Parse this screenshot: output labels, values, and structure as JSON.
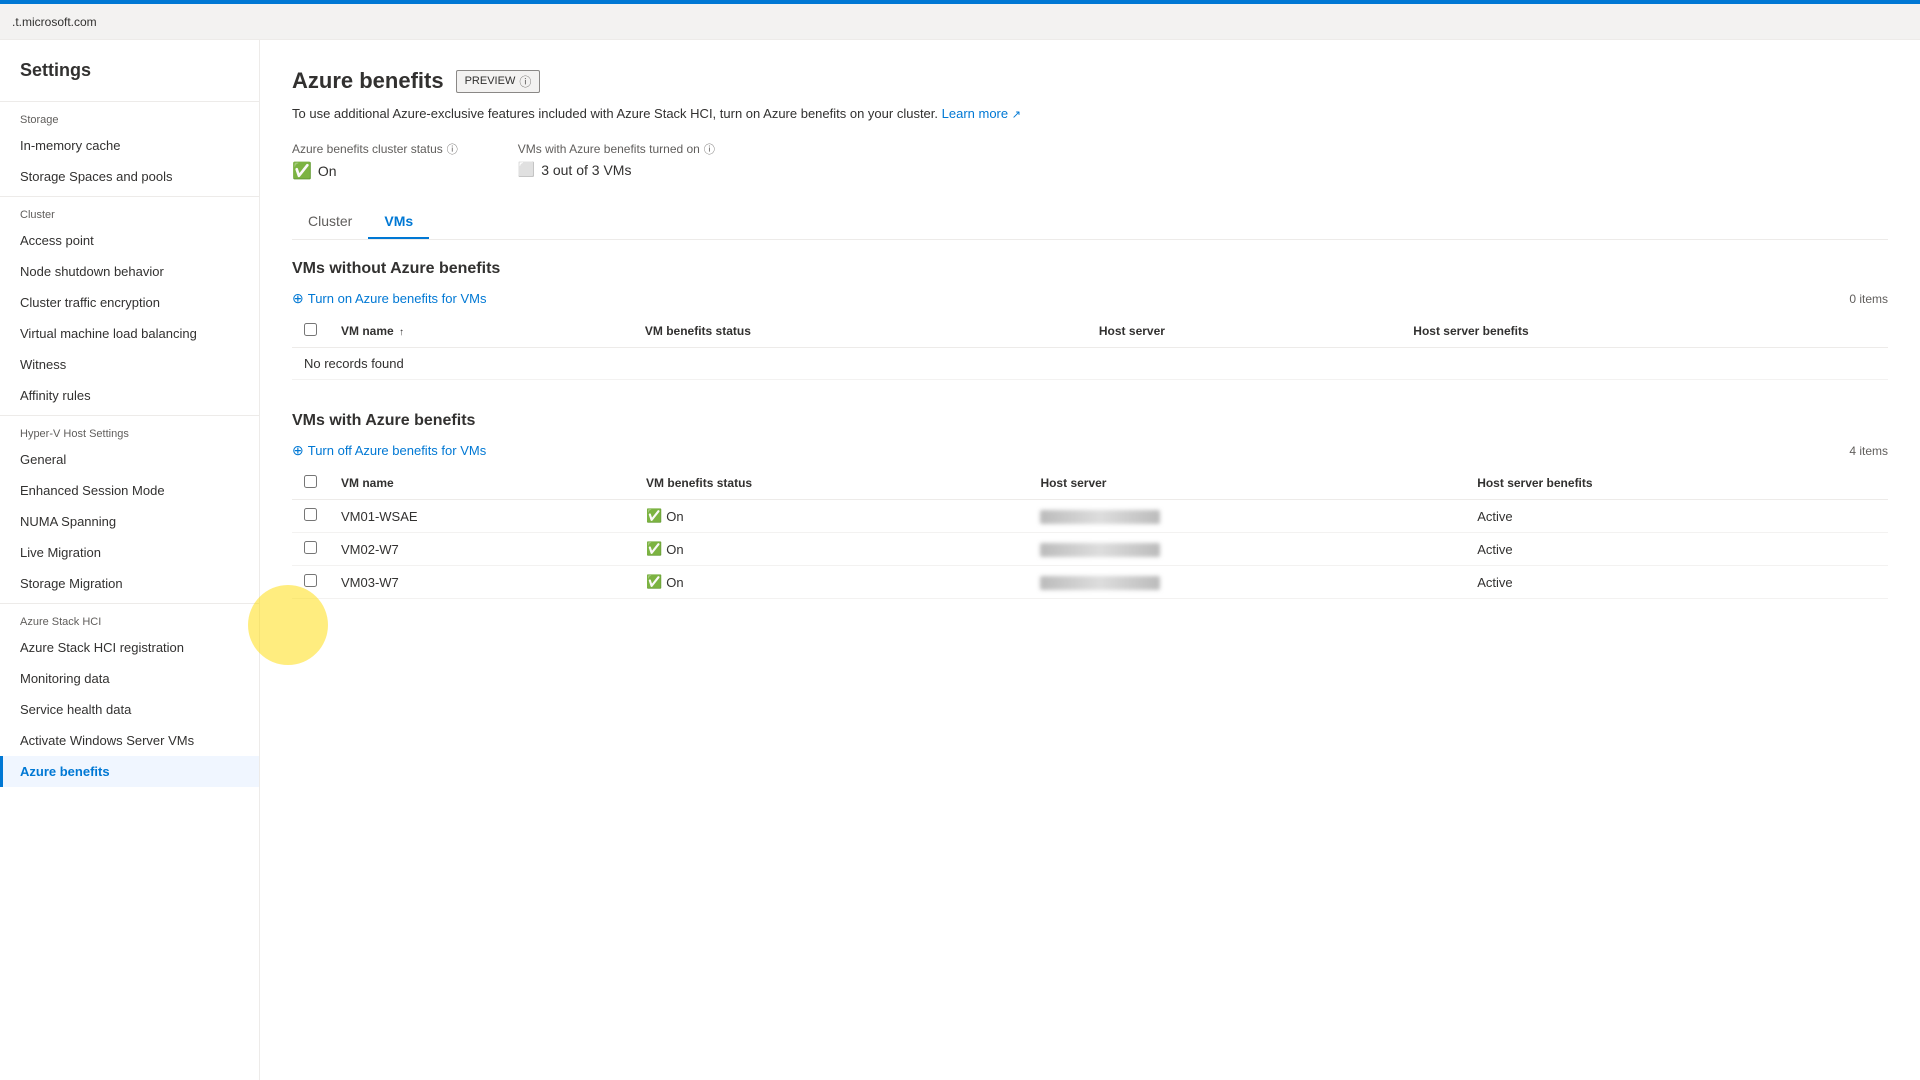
{
  "urlBar": {
    "text": ".t.microsoft.com"
  },
  "sidebar": {
    "title": "Settings",
    "sections": [
      {
        "label": "Storage",
        "items": [
          {
            "id": "in-memory-cache",
            "label": "In-memory cache",
            "active": false
          },
          {
            "id": "storage-spaces",
            "label": "Storage Spaces and pools",
            "active": false
          }
        ]
      },
      {
        "label": "Cluster",
        "items": [
          {
            "id": "access-point",
            "label": "Access point",
            "active": false
          },
          {
            "id": "node-shutdown",
            "label": "Node shutdown behavior",
            "active": false
          },
          {
            "id": "cluster-traffic",
            "label": "Cluster traffic encryption",
            "active": false
          },
          {
            "id": "vm-load-balancing",
            "label": "Virtual machine load balancing",
            "active": false
          },
          {
            "id": "witness",
            "label": "Witness",
            "active": false
          },
          {
            "id": "affinity-rules",
            "label": "Affinity rules",
            "active": false
          }
        ]
      },
      {
        "label": "Hyper-V Host Settings",
        "items": [
          {
            "id": "general",
            "label": "General",
            "active": false
          },
          {
            "id": "enhanced-session-mode",
            "label": "Enhanced Session Mode",
            "active": false
          },
          {
            "id": "numa-spanning",
            "label": "NUMA Spanning",
            "active": false
          },
          {
            "id": "live-migration",
            "label": "Live Migration",
            "active": false
          },
          {
            "id": "storage-migration",
            "label": "Storage Migration",
            "active": false
          }
        ]
      },
      {
        "label": "Azure Stack HCI",
        "items": [
          {
            "id": "azure-stack-hci-reg",
            "label": "Azure Stack HCI registration",
            "active": false
          },
          {
            "id": "monitoring-data",
            "label": "Monitoring data",
            "active": false
          },
          {
            "id": "service-health",
            "label": "Service health data",
            "active": false
          },
          {
            "id": "activate-windows",
            "label": "Activate Windows Server VMs",
            "active": false
          },
          {
            "id": "azure-benefits",
            "label": "Azure benefits",
            "active": true
          }
        ]
      }
    ]
  },
  "page": {
    "title": "Azure benefits",
    "previewLabel": "PREVIEW",
    "description": "To use additional Azure-exclusive features included with Azure Stack HCI, turn on Azure benefits on your cluster.",
    "learnMoreLabel": "Learn more",
    "clusterStatus": {
      "label": "Azure benefits cluster status",
      "value": "On"
    },
    "vmsStatus": {
      "label": "VMs with Azure benefits turned on",
      "value": "3 out of 3 VMs"
    },
    "tabs": [
      {
        "id": "cluster",
        "label": "Cluster"
      },
      {
        "id": "vms",
        "label": "VMs"
      }
    ],
    "activeTab": "vms",
    "vmsWithoutSection": {
      "title": "VMs without Azure benefits",
      "actionLabel": "Turn on Azure benefits for VMs",
      "itemsCount": "0 items",
      "columns": [
        "VM name",
        "VM benefits status",
        "Host server",
        "Host server benefits"
      ],
      "noRecords": "No records found"
    },
    "vmsWithSection": {
      "title": "VMs with Azure benefits",
      "actionLabel": "Turn off Azure benefits for VMs",
      "itemsCount": "4 items",
      "columns": [
        "VM name",
        "VM benefits status",
        "Host server",
        "Host server benefits"
      ],
      "rows": [
        {
          "name": "VM01-WSAE",
          "status": "On",
          "hostServer": "blurred",
          "hostBenefits": "Active"
        },
        {
          "name": "VM02-W7",
          "status": "On",
          "hostServer": "blurred",
          "hostBenefits": "Active"
        },
        {
          "name": "VM03-W7",
          "status": "On",
          "hostServer": "blurred",
          "hostBenefits": "Active"
        }
      ]
    }
  }
}
